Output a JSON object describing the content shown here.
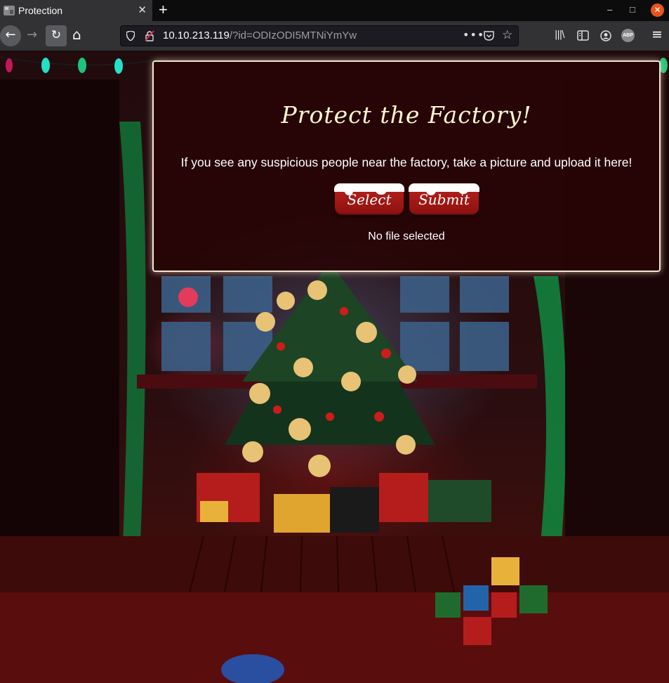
{
  "browser": {
    "tab_title": "Protection",
    "tab_close": "✕",
    "new_tab": "+",
    "url_host": "10.10.213.119",
    "url_query": "/?id=ODIzODI5MTNiYmYw",
    "url_actions": "•••",
    "bookmark_star": "☆",
    "window_minimize": "–",
    "window_maximize": "□",
    "window_close": "✕",
    "back": "←",
    "forward": "→",
    "reload": "↻",
    "home": "⌂",
    "menu": "≡",
    "library": "|||\\",
    "adblock_label": "ABP"
  },
  "page": {
    "heading": "Protect the Factory!",
    "message": "If you see any suspicious people near the factory, take a picture and upload it here!",
    "select_label": "Select",
    "submit_label": "Submit",
    "file_status": "No file selected"
  },
  "colors": {
    "card_border": "#f4e6cf",
    "heading": "#fff7cf",
    "button": "#a6191a",
    "window_close": "#e95420"
  }
}
